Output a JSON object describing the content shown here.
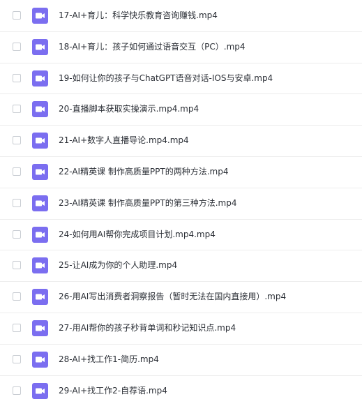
{
  "icon_color": "#7b6ef0",
  "files": [
    {
      "name": "17-AI+育儿：科学快乐教育咨询赚钱.mp4",
      "icon": "video-file-icon"
    },
    {
      "name": "18-AI+育儿：孩子如何通过语音交互（PC）.mp4",
      "icon": "video-file-icon"
    },
    {
      "name": "19-如何让你的孩子与ChatGPT语音对话-IOS与安卓.mp4",
      "icon": "video-file-icon"
    },
    {
      "name": "20-直播脚本获取实操演示.mp4.mp4",
      "icon": "video-file-icon"
    },
    {
      "name": "21-AI+数字人直播导论.mp4.mp4",
      "icon": "video-file-icon"
    },
    {
      "name": "22-AI精英课 制作高质量PPT的两种方法.mp4",
      "icon": "video-file-icon"
    },
    {
      "name": "23-AI精英课 制作高质量PPT的第三种方法.mp4",
      "icon": "video-file-icon"
    },
    {
      "name": "24-如何用AI帮你完成项目计划.mp4.mp4",
      "icon": "video-file-icon"
    },
    {
      "name": "25-让AI成为你的个人助理.mp4",
      "icon": "video-file-icon"
    },
    {
      "name": "26-用AI写出消费者洞察报告（暂时无法在国内直接用）.mp4",
      "icon": "video-file-icon"
    },
    {
      "name": "27-用AI帮你的孩子秒背单词和秒记知识点.mp4",
      "icon": "video-file-icon"
    },
    {
      "name": "28-AI+找工作1-简历.mp4",
      "icon": "video-file-icon"
    },
    {
      "name": "29-AI+找工作2-自荐语.mp4",
      "icon": "video-file-icon"
    }
  ]
}
